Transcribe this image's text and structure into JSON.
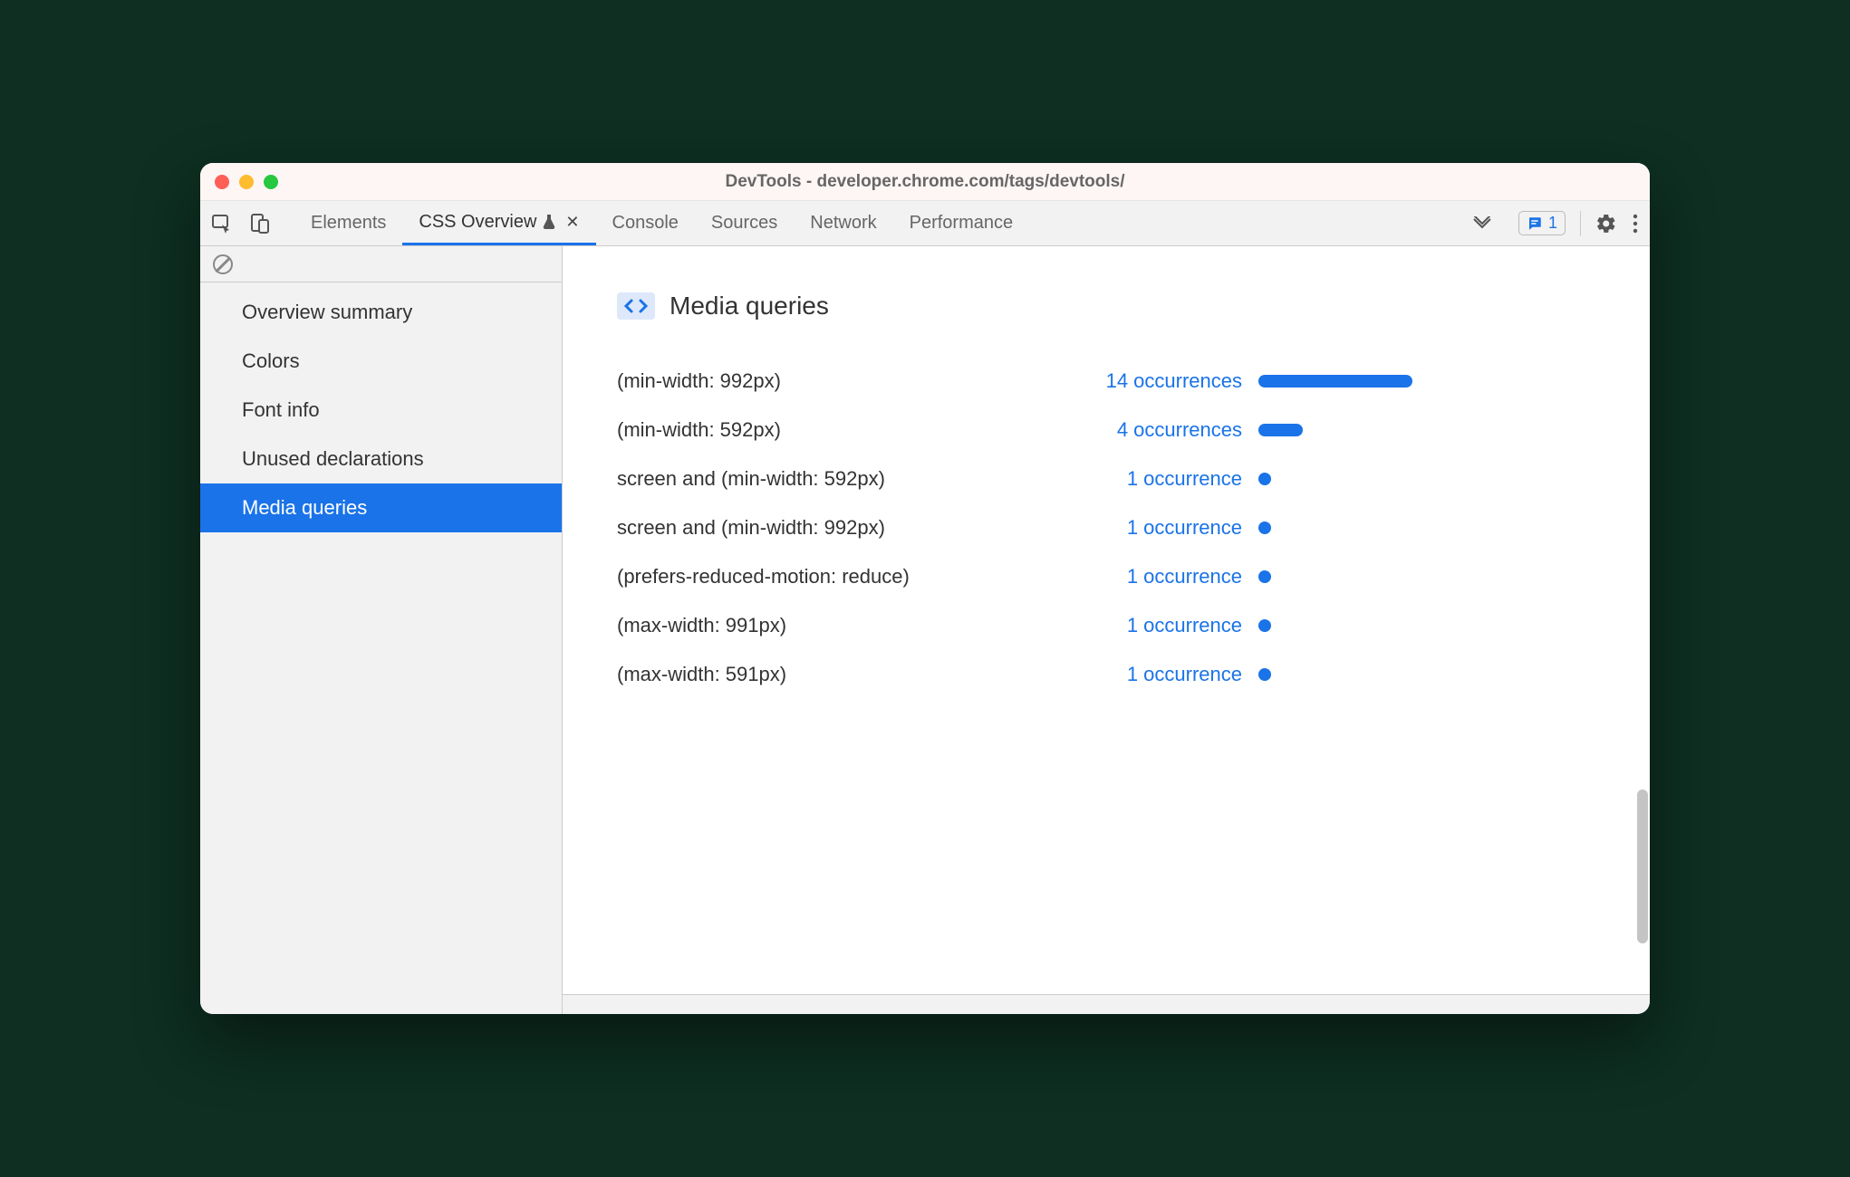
{
  "window": {
    "title": "DevTools - developer.chrome.com/tags/devtools/"
  },
  "toolbar": {
    "tabs": [
      {
        "label": "Elements",
        "active": false,
        "experimental": false,
        "closeable": false
      },
      {
        "label": "CSS Overview",
        "active": true,
        "experimental": true,
        "closeable": true
      },
      {
        "label": "Console",
        "active": false,
        "experimental": false,
        "closeable": false
      },
      {
        "label": "Sources",
        "active": false,
        "experimental": false,
        "closeable": false
      },
      {
        "label": "Network",
        "active": false,
        "experimental": false,
        "closeable": false
      },
      {
        "label": "Performance",
        "active": false,
        "experimental": false,
        "closeable": false
      }
    ],
    "issues_count": "1"
  },
  "sidebar": {
    "items": [
      {
        "label": "Overview summary",
        "active": false
      },
      {
        "label": "Colors",
        "active": false
      },
      {
        "label": "Font info",
        "active": false
      },
      {
        "label": "Unused declarations",
        "active": false
      },
      {
        "label": "Media queries",
        "active": true
      }
    ]
  },
  "main": {
    "section_title": "Media queries",
    "queries": [
      {
        "query": "(min-width: 992px)",
        "count": 14,
        "label": "14 occurrences"
      },
      {
        "query": "(min-width: 592px)",
        "count": 4,
        "label": "4 occurrences"
      },
      {
        "query": "screen and (min-width: 592px)",
        "count": 1,
        "label": "1 occurrence"
      },
      {
        "query": "screen and (min-width: 992px)",
        "count": 1,
        "label": "1 occurrence"
      },
      {
        "query": "(prefers-reduced-motion: reduce)",
        "count": 1,
        "label": "1 occurrence"
      },
      {
        "query": "(max-width: 991px)",
        "count": 1,
        "label": "1 occurrence"
      },
      {
        "query": "(max-width: 591px)",
        "count": 1,
        "label": "1 occurrence"
      }
    ]
  },
  "colors": {
    "accent": "#1a73e8",
    "sidebar_bg": "#f2f2f2"
  },
  "chart_data": {
    "type": "bar",
    "title": "Media queries",
    "xlabel": "",
    "ylabel": "occurrences",
    "categories": [
      "(min-width: 992px)",
      "(min-width: 592px)",
      "screen and (min-width: 592px)",
      "screen and (min-width: 992px)",
      "(prefers-reduced-motion: reduce)",
      "(max-width: 991px)",
      "(max-width: 591px)"
    ],
    "values": [
      14,
      4,
      1,
      1,
      1,
      1,
      1
    ],
    "ylim": [
      0,
      14
    ]
  }
}
